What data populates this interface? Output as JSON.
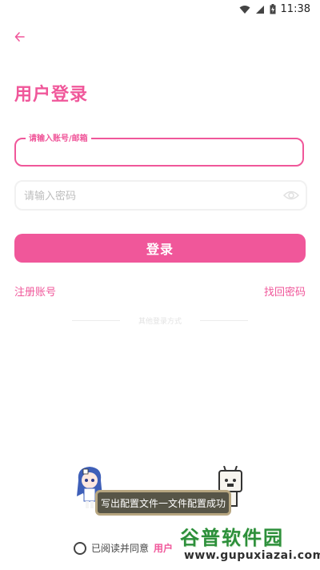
{
  "colors": {
    "accent": "#f0579a"
  },
  "status_bar": {
    "time": "11:38",
    "icons": [
      "wifi-icon",
      "signal-icon",
      "battery-icon"
    ]
  },
  "header": {
    "back_icon": "arrow-left-icon",
    "title": "用户登录"
  },
  "form": {
    "account_label": "请输入账号/邮箱",
    "account_value": "",
    "password_placeholder": "请输入密码",
    "password_value": "",
    "login_button": "登录",
    "register_link": "注册账号",
    "forgot_link": "找回密码",
    "divider_text": "其他登录方式"
  },
  "toast": {
    "message": "写出配置文件一文件配置成功"
  },
  "agreement": {
    "text": "已阅读并同意",
    "link": "用户"
  },
  "watermark": {
    "title": "谷普软件园",
    "url": "www.gupuxiazai.com"
  }
}
